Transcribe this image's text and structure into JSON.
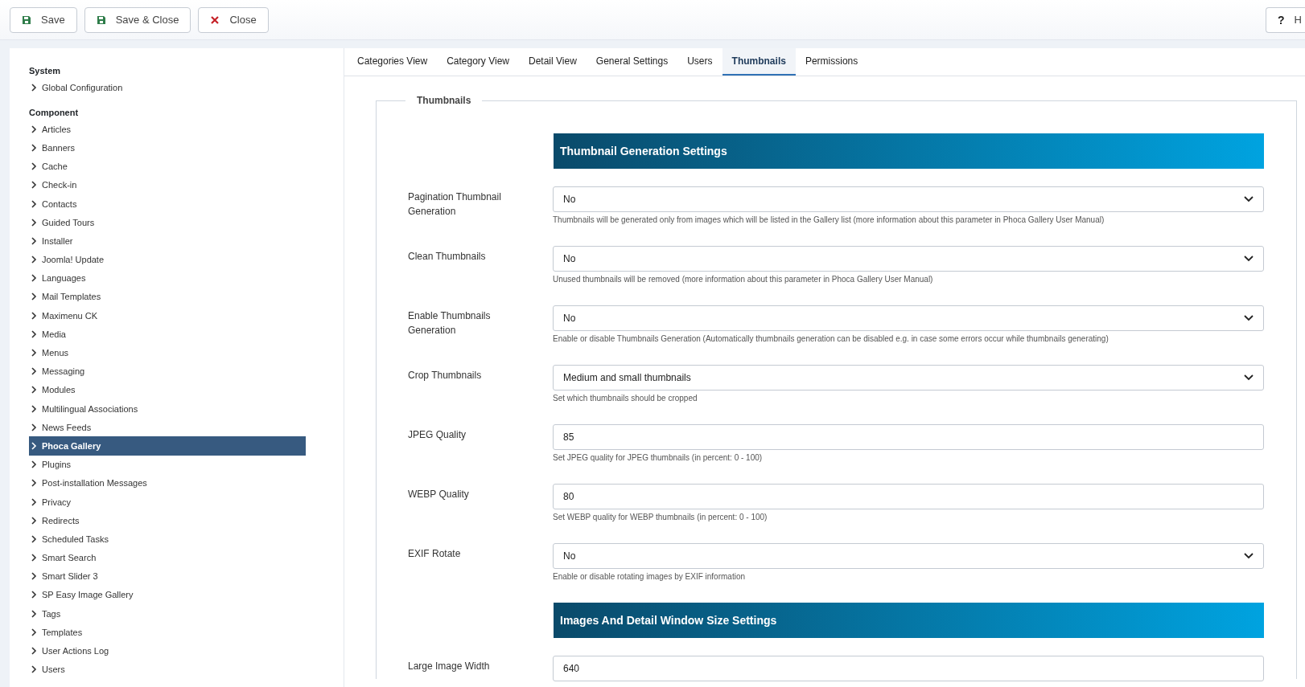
{
  "toolbar": {
    "buttons": [
      {
        "label": "Save",
        "kind": "save"
      },
      {
        "label": "Save & Close",
        "kind": "save"
      },
      {
        "label": "Close",
        "kind": "close"
      }
    ],
    "help": {
      "icon": "?",
      "label": "H"
    }
  },
  "sidebar": {
    "groups": [
      {
        "title": "System",
        "items": [
          {
            "label": "Global Configuration",
            "selected": false
          }
        ]
      },
      {
        "title": "Component",
        "items": [
          {
            "label": "Articles",
            "selected": false
          },
          {
            "label": "Banners",
            "selected": false
          },
          {
            "label": "Cache",
            "selected": false
          },
          {
            "label": "Check-in",
            "selected": false
          },
          {
            "label": "Contacts",
            "selected": false
          },
          {
            "label": "Guided Tours",
            "selected": false
          },
          {
            "label": "Installer",
            "selected": false
          },
          {
            "label": "Joomla! Update",
            "selected": false
          },
          {
            "label": "Languages",
            "selected": false
          },
          {
            "label": "Mail Templates",
            "selected": false
          },
          {
            "label": "Maximenu CK",
            "selected": false
          },
          {
            "label": "Media",
            "selected": false
          },
          {
            "label": "Menus",
            "selected": false
          },
          {
            "label": "Messaging",
            "selected": false
          },
          {
            "label": "Modules",
            "selected": false
          },
          {
            "label": "Multilingual Associations",
            "selected": false
          },
          {
            "label": "News Feeds",
            "selected": false
          },
          {
            "label": "Phoca Gallery",
            "selected": true
          },
          {
            "label": "Plugins",
            "selected": false
          },
          {
            "label": "Post-installation Messages",
            "selected": false
          },
          {
            "label": "Privacy",
            "selected": false
          },
          {
            "label": "Redirects",
            "selected": false
          },
          {
            "label": "Scheduled Tasks",
            "selected": false
          },
          {
            "label": "Smart Search",
            "selected": false
          },
          {
            "label": "Smart Slider 3",
            "selected": false
          },
          {
            "label": "SP Easy Image Gallery",
            "selected": false
          },
          {
            "label": "Tags",
            "selected": false
          },
          {
            "label": "Templates",
            "selected": false
          },
          {
            "label": "User Actions Log",
            "selected": false
          },
          {
            "label": "Users",
            "selected": false
          }
        ]
      }
    ]
  },
  "tabs": [
    {
      "label": "Categories View",
      "selected": false
    },
    {
      "label": "Category View",
      "selected": false
    },
    {
      "label": "Detail View",
      "selected": false
    },
    {
      "label": "General Settings",
      "selected": false
    },
    {
      "label": "Users",
      "selected": false
    },
    {
      "label": "Thumbnails",
      "selected": true
    },
    {
      "label": "Permissions",
      "selected": false
    }
  ],
  "fieldset": {
    "legend": "Thumbnails",
    "rows": [
      {
        "kind": "heading",
        "title": "Thumbnail Generation Settings"
      },
      {
        "kind": "select",
        "label": "Pagination Thumbnail Generation",
        "value": "No",
        "hint": "Thumbnails will be generated only from images which will be listed in the Gallery list (more information about this parameter in Phoca Gallery User Manual)"
      },
      {
        "kind": "select",
        "label": "Clean Thumbnails",
        "value": "No",
        "hint": "Unused thumbnails will be removed (more information about this parameter in Phoca Gallery User Manual)"
      },
      {
        "kind": "select",
        "label": "Enable Thumbnails Generation",
        "value": "No",
        "hint": "Enable or disable Thumbnails Generation (Automatically thumbnails generation can be disabled e.g. in case some errors occur while thumbnails generating)"
      },
      {
        "kind": "select",
        "label": "Crop Thumbnails",
        "value": "Medium and small thumbnails",
        "hint": "Set which thumbnails should be cropped"
      },
      {
        "kind": "text",
        "label": "JPEG Quality",
        "value": "85",
        "hint": "Set JPEG quality for JPEG thumbnails (in percent: 0 - 100)"
      },
      {
        "kind": "text",
        "label": "WEBP Quality",
        "value": "80",
        "hint": "Set WEBP quality for WEBP thumbnails (in percent: 0 - 100)"
      },
      {
        "kind": "select",
        "label": "EXIF Rotate",
        "value": "No",
        "hint": "Enable or disable rotating images by EXIF information"
      },
      {
        "kind": "heading",
        "title": "Images And Detail Window Size Settings"
      },
      {
        "kind": "text",
        "label": "Large Image Width",
        "value": "640"
      }
    ]
  }
}
